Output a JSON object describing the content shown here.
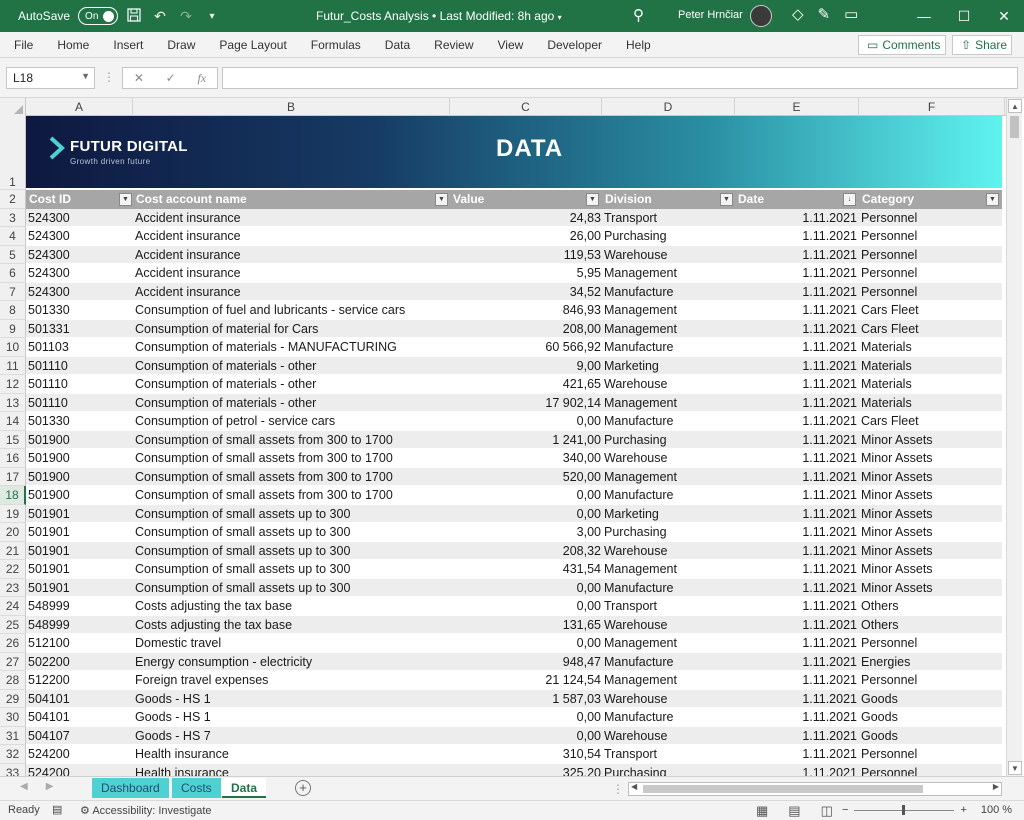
{
  "titlebar": {
    "autosave_label": "AutoSave",
    "autosave_state": "On",
    "title": "Futur_Costs Analysis • Last Modified: 8h ago",
    "user": "Peter Hrnčiar"
  },
  "ribbon": {
    "tabs": [
      "File",
      "Home",
      "Insert",
      "Draw",
      "Page Layout",
      "Formulas",
      "Data",
      "Review",
      "View",
      "Developer",
      "Help"
    ],
    "comments_label": "Comments",
    "share_label": "Share"
  },
  "formulabar": {
    "namebox": "L18",
    "fx": "fx",
    "formula": ""
  },
  "columns": [
    "A",
    "B",
    "C",
    "D",
    "E",
    "F"
  ],
  "banner": {
    "company": "FUTUR DIGITAL",
    "tagline": "Growth driven future",
    "title": "DATA"
  },
  "table": {
    "headers": [
      "Cost ID",
      "Cost account name",
      "Value",
      "Division",
      "Date",
      "Category"
    ],
    "rows": [
      [
        "524300",
        "Accident insurance",
        "24,83",
        "Transport",
        "1.11.2021",
        "Personnel"
      ],
      [
        "524300",
        "Accident insurance",
        "26,00",
        "Purchasing",
        "1.11.2021",
        "Personnel"
      ],
      [
        "524300",
        "Accident insurance",
        "119,53",
        "Warehouse",
        "1.11.2021",
        "Personnel"
      ],
      [
        "524300",
        "Accident insurance",
        "5,95",
        "Management",
        "1.11.2021",
        "Personnel"
      ],
      [
        "524300",
        "Accident insurance",
        "34,52",
        "Manufacture",
        "1.11.2021",
        "Personnel"
      ],
      [
        "501330",
        "Consumption of fuel and lubricants - service cars",
        "846,93",
        "Management",
        "1.11.2021",
        "Cars Fleet"
      ],
      [
        "501331",
        "Consumption of material for  Cars",
        "208,00",
        "Management",
        "1.11.2021",
        "Cars Fleet"
      ],
      [
        "501103",
        "Consumption of materials - MANUFACTURING",
        "60 566,92",
        "Manufacture",
        "1.11.2021",
        "Materials"
      ],
      [
        "501110",
        "Consumption of materials - other",
        "9,00",
        "Marketing",
        "1.11.2021",
        "Materials"
      ],
      [
        "501110",
        "Consumption of materials - other",
        "421,65",
        "Warehouse",
        "1.11.2021",
        "Materials"
      ],
      [
        "501110",
        "Consumption of materials - other",
        "17 902,14",
        "Management",
        "1.11.2021",
        "Materials"
      ],
      [
        "501330",
        "Consumption of petrol - service cars",
        "0,00",
        "Manufacture",
        "1.11.2021",
        "Cars Fleet"
      ],
      [
        "501900",
        "Consumption of small assets from 300 to 1700",
        "1 241,00",
        "Purchasing",
        "1.11.2021",
        "Minor Assets"
      ],
      [
        "501900",
        "Consumption of small assets from 300 to 1700",
        "340,00",
        "Warehouse",
        "1.11.2021",
        "Minor Assets"
      ],
      [
        "501900",
        "Consumption of small assets from 300 to 1700",
        "520,00",
        "Management",
        "1.11.2021",
        "Minor Assets"
      ],
      [
        "501900",
        "Consumption of small assets from 300 to 1700",
        "0,00",
        "Manufacture",
        "1.11.2021",
        "Minor Assets"
      ],
      [
        "501901",
        "Consumption of small assets up to 300",
        "0,00",
        "Marketing",
        "1.11.2021",
        "Minor Assets"
      ],
      [
        "501901",
        "Consumption of small assets up to 300",
        "3,00",
        "Purchasing",
        "1.11.2021",
        "Minor Assets"
      ],
      [
        "501901",
        "Consumption of small assets up to 300",
        "208,32",
        "Warehouse",
        "1.11.2021",
        "Minor Assets"
      ],
      [
        "501901",
        "Consumption of small assets up to 300",
        "431,54",
        "Management",
        "1.11.2021",
        "Minor Assets"
      ],
      [
        "501901",
        "Consumption of small assets up to 300",
        "0,00",
        "Manufacture",
        "1.11.2021",
        "Minor Assets"
      ],
      [
        "548999",
        "Costs adjusting the tax base",
        "0,00",
        "Transport",
        "1.11.2021",
        "Others"
      ],
      [
        "548999",
        "Costs adjusting the tax base",
        "131,65",
        "Warehouse",
        "1.11.2021",
        "Others"
      ],
      [
        "512100",
        "Domestic travel",
        "0,00",
        "Management",
        "1.11.2021",
        "Personnel"
      ],
      [
        "502200",
        "Energy consumption - electricity",
        "948,47",
        "Manufacture",
        "1.11.2021",
        "Energies"
      ],
      [
        "512200",
        "Foreign travel expenses",
        "21 124,54",
        "Management",
        "1.11.2021",
        "Personnel"
      ],
      [
        "504101",
        "Goods - HS 1",
        "1 587,03",
        "Warehouse",
        "1.11.2021",
        "Goods"
      ],
      [
        "504101",
        "Goods - HS 1",
        "0,00",
        "Manufacture",
        "1.11.2021",
        "Goods"
      ],
      [
        "504107",
        "Goods - HS 7",
        "0,00",
        "Warehouse",
        "1.11.2021",
        "Goods"
      ],
      [
        "524200",
        "Health insurance",
        "310,54",
        "Transport",
        "1.11.2021",
        "Personnel"
      ],
      [
        "524200",
        "Health insurance",
        "325,20",
        "Purchasing",
        "1.11.2021",
        "Personnel"
      ]
    ]
  },
  "sheets": [
    "Dashboard",
    "Costs",
    "Data"
  ],
  "active_sheet": "Data",
  "status": {
    "ready": "Ready",
    "accessibility": "Accessibility: Investigate",
    "zoom": "100 %"
  },
  "colors": {
    "excel_green": "#217346",
    "banner_start": "#0e1840",
    "banner_end": "#5ff3f0",
    "header_gray": "#a6a6a6",
    "tab_teal": "#4fd1d1"
  }
}
